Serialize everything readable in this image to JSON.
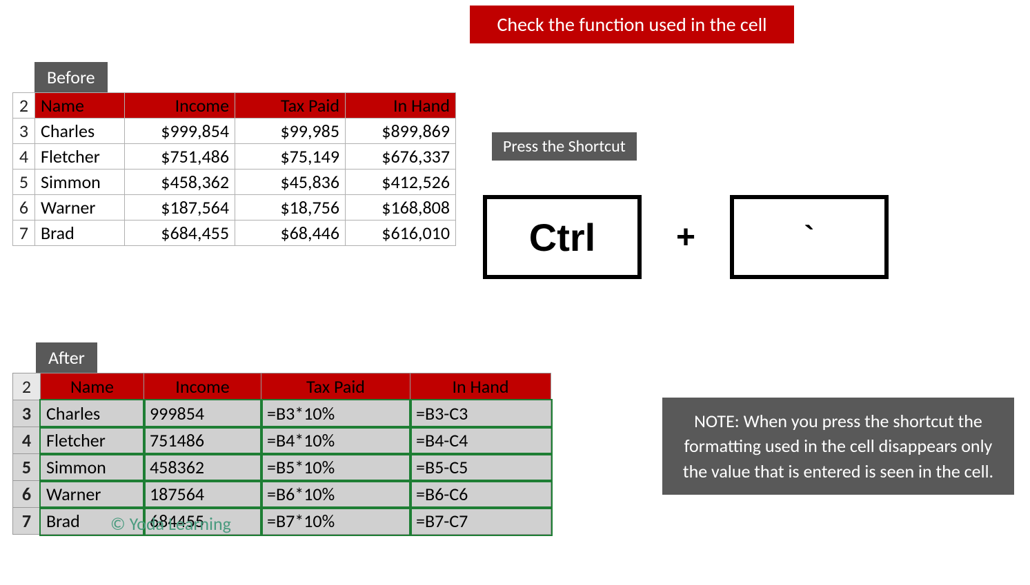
{
  "title": "Check the function used in the cell",
  "labels": {
    "before": "Before",
    "after": "After",
    "shortcut": "Press the Shortcut"
  },
  "headers": {
    "name": "Name",
    "income": "Income",
    "tax": "Tax Paid",
    "inhand": "In Hand"
  },
  "before_rows": [
    {
      "n": "2"
    },
    {
      "n": "3",
      "name": "Charles",
      "income": "$999,854",
      "tax": "$99,985",
      "inhand": "$899,869"
    },
    {
      "n": "4",
      "name": "Fletcher",
      "income": "$751,486",
      "tax": "$75,149",
      "inhand": "$676,337"
    },
    {
      "n": "5",
      "name": "Simmon",
      "income": "$458,362",
      "tax": "$45,836",
      "inhand": "$412,526"
    },
    {
      "n": "6",
      "name": "Warner",
      "income": "$187,564",
      "tax": "$18,756",
      "inhand": "$168,808"
    },
    {
      "n": "7",
      "name": "Brad",
      "income": "$684,455",
      "tax": "$68,446",
      "inhand": "$616,010"
    }
  ],
  "after_rows": [
    {
      "n": "2"
    },
    {
      "n": "3",
      "name": "Charles",
      "income": "999854",
      "tax": "=B3*10%",
      "inhand": "=B3-C3"
    },
    {
      "n": "4",
      "name": "Fletcher",
      "income": "751486",
      "tax": "=B4*10%",
      "inhand": "=B4-C4"
    },
    {
      "n": "5",
      "name": "Simmon",
      "income": "458362",
      "tax": "=B5*10%",
      "inhand": "=B5-C5"
    },
    {
      "n": "6",
      "name": "Warner",
      "income": "187564",
      "tax": "=B6*10%",
      "inhand": "=B6-C6"
    },
    {
      "n": "7",
      "name": "Brad",
      "income": "684455",
      "tax": "=B7*10%",
      "inhand": "=B7-C7"
    }
  ],
  "keys": {
    "ctrl": "Ctrl",
    "plus": "+",
    "tilde": "`"
  },
  "note": "NOTE: When you press the shortcut the formatting used in the cell disappears only the value that is entered is seen in the cell.",
  "watermark": "© Yoda Learning"
}
